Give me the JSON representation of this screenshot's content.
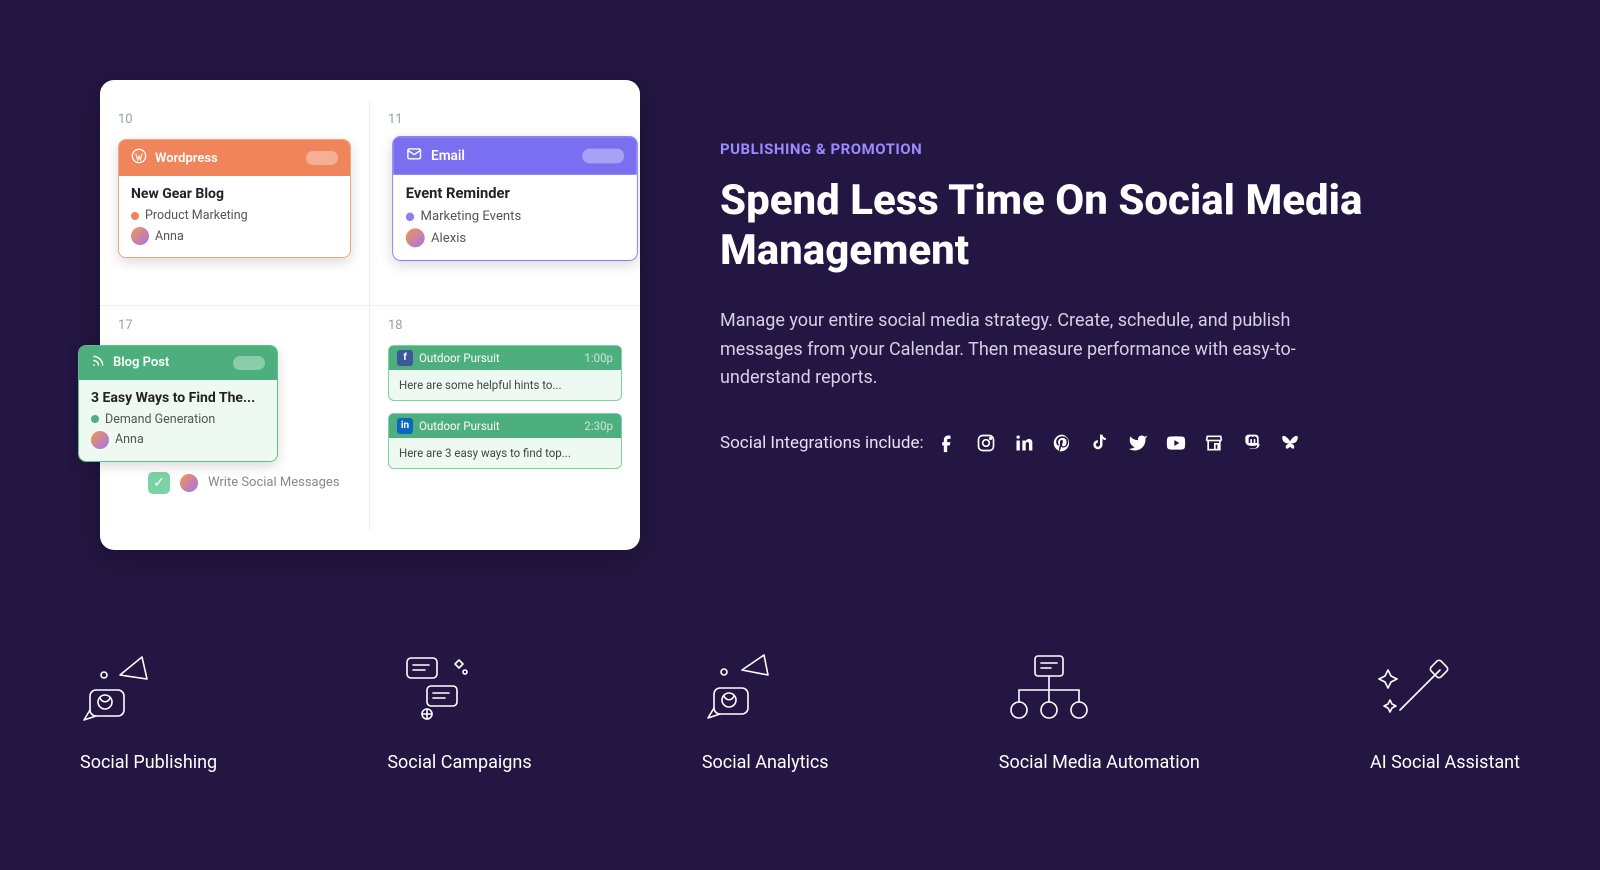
{
  "calendar": {
    "days": [
      "10",
      "11",
      "17",
      "18"
    ],
    "wordpress": {
      "platform": "Wordpress",
      "title": "New Gear Blog",
      "tag": "Product Marketing",
      "author": "Anna"
    },
    "email": {
      "platform": "Email",
      "title": "Event Reminder",
      "tag": "Marketing Events",
      "author": "Alexis"
    },
    "blogpost": {
      "platform": "Blog Post",
      "title": "3 Easy Ways to Find The...",
      "tag": "Demand Generation",
      "author": "Anna"
    },
    "fb_post": {
      "channel": "Outdoor Pursuit",
      "time": "1:00p",
      "body": "Here are some helpful hints to..."
    },
    "li_post": {
      "channel": "Outdoor Pursuit",
      "time": "2:30p",
      "body": "Here are 3 easy ways to find top..."
    },
    "task": "Write Social Messages"
  },
  "content": {
    "eyebrow": "PUBLISHING & PROMOTION",
    "headline": "Spend Less Time On Social Media Management",
    "description": "Manage your entire social media strategy. Create, schedule, and publish messages from your Calendar. Then measure performance with easy-to-understand reports.",
    "integrations_label": "Social Integrations include:"
  },
  "features": [
    {
      "label": "Social Publishing"
    },
    {
      "label": "Social Campaigns"
    },
    {
      "label": "Social Analytics"
    },
    {
      "label": "Social Media Automation"
    },
    {
      "label": "AI Social Assistant"
    }
  ]
}
